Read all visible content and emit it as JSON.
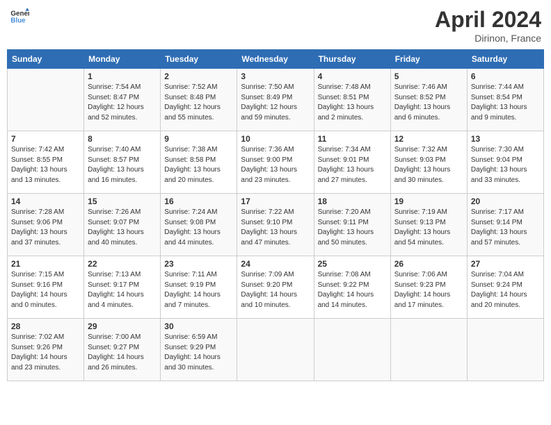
{
  "header": {
    "logo_line1": "General",
    "logo_line2": "Blue",
    "month_year": "April 2024",
    "location": "Dirinon, France"
  },
  "columns": [
    "Sunday",
    "Monday",
    "Tuesday",
    "Wednesday",
    "Thursday",
    "Friday",
    "Saturday"
  ],
  "weeks": [
    [
      {
        "num": "",
        "info": ""
      },
      {
        "num": "1",
        "info": "Sunrise: 7:54 AM\nSunset: 8:47 PM\nDaylight: 12 hours\nand 52 minutes."
      },
      {
        "num": "2",
        "info": "Sunrise: 7:52 AM\nSunset: 8:48 PM\nDaylight: 12 hours\nand 55 minutes."
      },
      {
        "num": "3",
        "info": "Sunrise: 7:50 AM\nSunset: 8:49 PM\nDaylight: 12 hours\nand 59 minutes."
      },
      {
        "num": "4",
        "info": "Sunrise: 7:48 AM\nSunset: 8:51 PM\nDaylight: 13 hours\nand 2 minutes."
      },
      {
        "num": "5",
        "info": "Sunrise: 7:46 AM\nSunset: 8:52 PM\nDaylight: 13 hours\nand 6 minutes."
      },
      {
        "num": "6",
        "info": "Sunrise: 7:44 AM\nSunset: 8:54 PM\nDaylight: 13 hours\nand 9 minutes."
      }
    ],
    [
      {
        "num": "7",
        "info": "Sunrise: 7:42 AM\nSunset: 8:55 PM\nDaylight: 13 hours\nand 13 minutes."
      },
      {
        "num": "8",
        "info": "Sunrise: 7:40 AM\nSunset: 8:57 PM\nDaylight: 13 hours\nand 16 minutes."
      },
      {
        "num": "9",
        "info": "Sunrise: 7:38 AM\nSunset: 8:58 PM\nDaylight: 13 hours\nand 20 minutes."
      },
      {
        "num": "10",
        "info": "Sunrise: 7:36 AM\nSunset: 9:00 PM\nDaylight: 13 hours\nand 23 minutes."
      },
      {
        "num": "11",
        "info": "Sunrise: 7:34 AM\nSunset: 9:01 PM\nDaylight: 13 hours\nand 27 minutes."
      },
      {
        "num": "12",
        "info": "Sunrise: 7:32 AM\nSunset: 9:03 PM\nDaylight: 13 hours\nand 30 minutes."
      },
      {
        "num": "13",
        "info": "Sunrise: 7:30 AM\nSunset: 9:04 PM\nDaylight: 13 hours\nand 33 minutes."
      }
    ],
    [
      {
        "num": "14",
        "info": "Sunrise: 7:28 AM\nSunset: 9:06 PM\nDaylight: 13 hours\nand 37 minutes."
      },
      {
        "num": "15",
        "info": "Sunrise: 7:26 AM\nSunset: 9:07 PM\nDaylight: 13 hours\nand 40 minutes."
      },
      {
        "num": "16",
        "info": "Sunrise: 7:24 AM\nSunset: 9:08 PM\nDaylight: 13 hours\nand 44 minutes."
      },
      {
        "num": "17",
        "info": "Sunrise: 7:22 AM\nSunset: 9:10 PM\nDaylight: 13 hours\nand 47 minutes."
      },
      {
        "num": "18",
        "info": "Sunrise: 7:20 AM\nSunset: 9:11 PM\nDaylight: 13 hours\nand 50 minutes."
      },
      {
        "num": "19",
        "info": "Sunrise: 7:19 AM\nSunset: 9:13 PM\nDaylight: 13 hours\nand 54 minutes."
      },
      {
        "num": "20",
        "info": "Sunrise: 7:17 AM\nSunset: 9:14 PM\nDaylight: 13 hours\nand 57 minutes."
      }
    ],
    [
      {
        "num": "21",
        "info": "Sunrise: 7:15 AM\nSunset: 9:16 PM\nDaylight: 14 hours\nand 0 minutes."
      },
      {
        "num": "22",
        "info": "Sunrise: 7:13 AM\nSunset: 9:17 PM\nDaylight: 14 hours\nand 4 minutes."
      },
      {
        "num": "23",
        "info": "Sunrise: 7:11 AM\nSunset: 9:19 PM\nDaylight: 14 hours\nand 7 minutes."
      },
      {
        "num": "24",
        "info": "Sunrise: 7:09 AM\nSunset: 9:20 PM\nDaylight: 14 hours\nand 10 minutes."
      },
      {
        "num": "25",
        "info": "Sunrise: 7:08 AM\nSunset: 9:22 PM\nDaylight: 14 hours\nand 14 minutes."
      },
      {
        "num": "26",
        "info": "Sunrise: 7:06 AM\nSunset: 9:23 PM\nDaylight: 14 hours\nand 17 minutes."
      },
      {
        "num": "27",
        "info": "Sunrise: 7:04 AM\nSunset: 9:24 PM\nDaylight: 14 hours\nand 20 minutes."
      }
    ],
    [
      {
        "num": "28",
        "info": "Sunrise: 7:02 AM\nSunset: 9:26 PM\nDaylight: 14 hours\nand 23 minutes."
      },
      {
        "num": "29",
        "info": "Sunrise: 7:00 AM\nSunset: 9:27 PM\nDaylight: 14 hours\nand 26 minutes."
      },
      {
        "num": "30",
        "info": "Sunrise: 6:59 AM\nSunset: 9:29 PM\nDaylight: 14 hours\nand 30 minutes."
      },
      {
        "num": "",
        "info": ""
      },
      {
        "num": "",
        "info": ""
      },
      {
        "num": "",
        "info": ""
      },
      {
        "num": "",
        "info": ""
      }
    ]
  ]
}
